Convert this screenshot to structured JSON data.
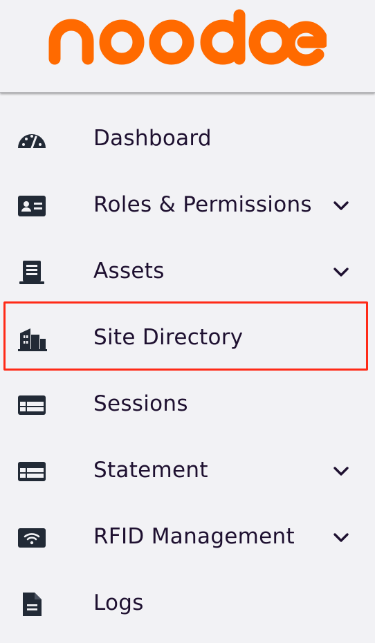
{
  "brand": {
    "name": "noodoe",
    "color": "#ff6a00"
  },
  "colors": {
    "icon": "#222a36",
    "text": "#1e1030",
    "highlight": "#ff2a17",
    "background": "#f2f2f5"
  },
  "nav": {
    "items": [
      {
        "label": "Dashboard",
        "icon": "speedometer-icon",
        "expandable": false
      },
      {
        "label": "Roles & Permissions",
        "icon": "id-card-icon",
        "expandable": true
      },
      {
        "label": "Assets",
        "icon": "charger-icon",
        "expandable": true
      },
      {
        "label": "Site Directory",
        "icon": "buildings-icon",
        "expandable": false,
        "highlighted": true
      },
      {
        "label": "Sessions",
        "icon": "table-list-icon",
        "expandable": false
      },
      {
        "label": "Statement",
        "icon": "table-list-icon",
        "expandable": true
      },
      {
        "label": "RFID Management",
        "icon": "rfid-wifi-icon",
        "expandable": true
      },
      {
        "label": "Logs",
        "icon": "document-icon",
        "expandable": false
      }
    ]
  }
}
